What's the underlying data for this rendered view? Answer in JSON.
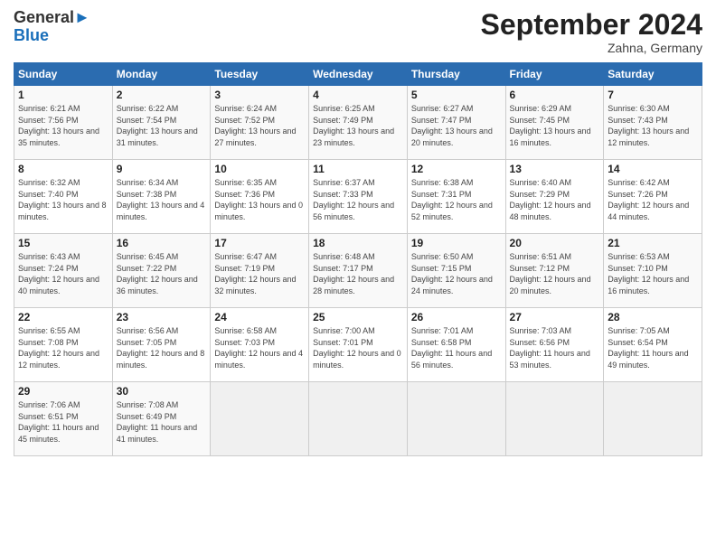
{
  "logo": {
    "line1": "General",
    "line2": "Blue"
  },
  "header": {
    "month": "September 2024",
    "location": "Zahna, Germany"
  },
  "weekdays": [
    "Sunday",
    "Monday",
    "Tuesday",
    "Wednesday",
    "Thursday",
    "Friday",
    "Saturday"
  ],
  "weeks": [
    [
      {
        "day": "1",
        "sunrise": "6:21 AM",
        "sunset": "7:56 PM",
        "daylight": "13 hours and 35 minutes."
      },
      {
        "day": "2",
        "sunrise": "6:22 AM",
        "sunset": "7:54 PM",
        "daylight": "13 hours and 31 minutes."
      },
      {
        "day": "3",
        "sunrise": "6:24 AM",
        "sunset": "7:52 PM",
        "daylight": "13 hours and 27 minutes."
      },
      {
        "day": "4",
        "sunrise": "6:25 AM",
        "sunset": "7:49 PM",
        "daylight": "13 hours and 23 minutes."
      },
      {
        "day": "5",
        "sunrise": "6:27 AM",
        "sunset": "7:47 PM",
        "daylight": "13 hours and 20 minutes."
      },
      {
        "day": "6",
        "sunrise": "6:29 AM",
        "sunset": "7:45 PM",
        "daylight": "13 hours and 16 minutes."
      },
      {
        "day": "7",
        "sunrise": "6:30 AM",
        "sunset": "7:43 PM",
        "daylight": "13 hours and 12 minutes."
      }
    ],
    [
      {
        "day": "8",
        "sunrise": "6:32 AM",
        "sunset": "7:40 PM",
        "daylight": "13 hours and 8 minutes."
      },
      {
        "day": "9",
        "sunrise": "6:34 AM",
        "sunset": "7:38 PM",
        "daylight": "13 hours and 4 minutes."
      },
      {
        "day": "10",
        "sunrise": "6:35 AM",
        "sunset": "7:36 PM",
        "daylight": "13 hours and 0 minutes."
      },
      {
        "day": "11",
        "sunrise": "6:37 AM",
        "sunset": "7:33 PM",
        "daylight": "12 hours and 56 minutes."
      },
      {
        "day": "12",
        "sunrise": "6:38 AM",
        "sunset": "7:31 PM",
        "daylight": "12 hours and 52 minutes."
      },
      {
        "day": "13",
        "sunrise": "6:40 AM",
        "sunset": "7:29 PM",
        "daylight": "12 hours and 48 minutes."
      },
      {
        "day": "14",
        "sunrise": "6:42 AM",
        "sunset": "7:26 PM",
        "daylight": "12 hours and 44 minutes."
      }
    ],
    [
      {
        "day": "15",
        "sunrise": "6:43 AM",
        "sunset": "7:24 PM",
        "daylight": "12 hours and 40 minutes."
      },
      {
        "day": "16",
        "sunrise": "6:45 AM",
        "sunset": "7:22 PM",
        "daylight": "12 hours and 36 minutes."
      },
      {
        "day": "17",
        "sunrise": "6:47 AM",
        "sunset": "7:19 PM",
        "daylight": "12 hours and 32 minutes."
      },
      {
        "day": "18",
        "sunrise": "6:48 AM",
        "sunset": "7:17 PM",
        "daylight": "12 hours and 28 minutes."
      },
      {
        "day": "19",
        "sunrise": "6:50 AM",
        "sunset": "7:15 PM",
        "daylight": "12 hours and 24 minutes."
      },
      {
        "day": "20",
        "sunrise": "6:51 AM",
        "sunset": "7:12 PM",
        "daylight": "12 hours and 20 minutes."
      },
      {
        "day": "21",
        "sunrise": "6:53 AM",
        "sunset": "7:10 PM",
        "daylight": "12 hours and 16 minutes."
      }
    ],
    [
      {
        "day": "22",
        "sunrise": "6:55 AM",
        "sunset": "7:08 PM",
        "daylight": "12 hours and 12 minutes."
      },
      {
        "day": "23",
        "sunrise": "6:56 AM",
        "sunset": "7:05 PM",
        "daylight": "12 hours and 8 minutes."
      },
      {
        "day": "24",
        "sunrise": "6:58 AM",
        "sunset": "7:03 PM",
        "daylight": "12 hours and 4 minutes."
      },
      {
        "day": "25",
        "sunrise": "7:00 AM",
        "sunset": "7:01 PM",
        "daylight": "12 hours and 0 minutes."
      },
      {
        "day": "26",
        "sunrise": "7:01 AM",
        "sunset": "6:58 PM",
        "daylight": "11 hours and 56 minutes."
      },
      {
        "day": "27",
        "sunrise": "7:03 AM",
        "sunset": "6:56 PM",
        "daylight": "11 hours and 53 minutes."
      },
      {
        "day": "28",
        "sunrise": "7:05 AM",
        "sunset": "6:54 PM",
        "daylight": "11 hours and 49 minutes."
      }
    ],
    [
      {
        "day": "29",
        "sunrise": "7:06 AM",
        "sunset": "6:51 PM",
        "daylight": "11 hours and 45 minutes."
      },
      {
        "day": "30",
        "sunrise": "7:08 AM",
        "sunset": "6:49 PM",
        "daylight": "11 hours and 41 minutes."
      },
      null,
      null,
      null,
      null,
      null
    ]
  ],
  "labels": {
    "sunrise": "Sunrise:",
    "sunset": "Sunset:",
    "daylight": "Daylight:"
  }
}
